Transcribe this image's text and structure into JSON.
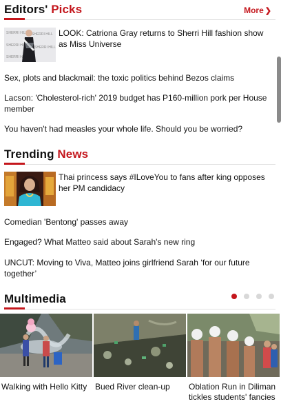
{
  "editors_picks": {
    "title_part1": "Editors'",
    "title_part2": "Picks",
    "more_label": "More",
    "more_chevron": "❯",
    "featured": {
      "text": "LOOK: Catriona Gray returns to Sherri Hill fashion show as Miss Universe",
      "thumb_icon": "fashion-photo-icon",
      "thumb_logo": "SHERRI HILL"
    },
    "items": [
      "Sex, plots and blackmail: the toxic politics behind Bezos claims",
      "Lacson: 'Cholesterol-rich' 2019 budget has P160-million pork per House member",
      "You haven't had measles your whole life. Should you be worried?"
    ]
  },
  "trending": {
    "title_part1": "Trending",
    "title_part2": "News",
    "featured": {
      "text": "Thai princess says #ILoveYou to fans after king opposes her PM candidacy",
      "thumb_icon": "portrait-photo-icon"
    },
    "items": [
      "Comedian 'Bentong' passes away",
      "Engaged? What Matteo said about Sarah's new ring",
      "UNCUT: Moving to Viva, Matteo joins girlfriend Sarah ‘for our future together’"
    ]
  },
  "multimedia": {
    "title": "Multimedia",
    "carousel": {
      "pages": 4,
      "active_page": 1
    },
    "cards": [
      {
        "caption": "Walking with Hello Kitty",
        "icon": "fountain-photo-icon"
      },
      {
        "caption": "Bued River clean-up",
        "icon": "river-photo-icon"
      },
      {
        "caption": "Oblation Run in Diliman tickles students' fancies",
        "icon": "crowd-photo-icon"
      }
    ]
  },
  "colors": {
    "accent": "#c4161c",
    "text": "#111111",
    "divider": "#e2e2e2"
  }
}
